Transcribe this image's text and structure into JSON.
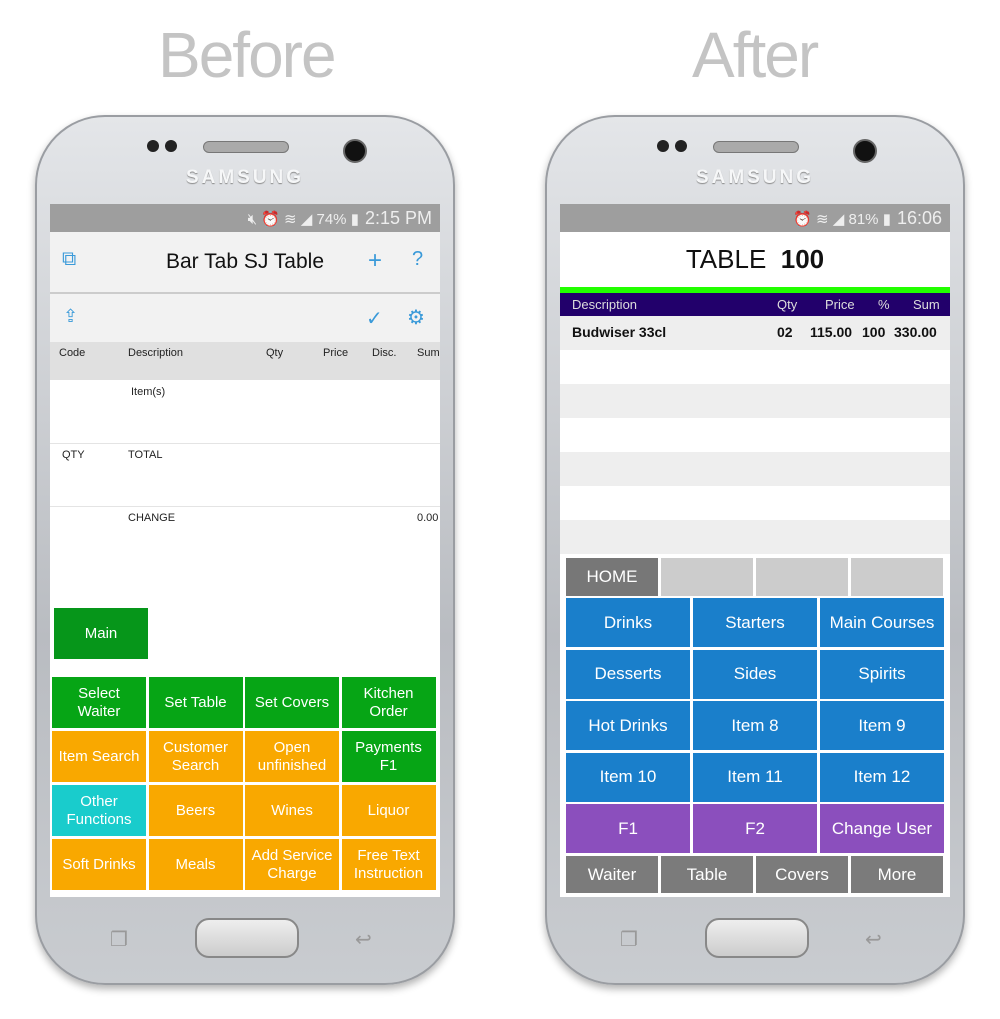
{
  "labels": {
    "before": "Before",
    "after": "After"
  },
  "brand": "SAMSUNG",
  "colors": {
    "green": "#06a515",
    "orange": "#f9a800",
    "cyan": "#19cccc",
    "blue": "#1a7fcb",
    "purple": "#8b4fbd",
    "header_purple": "#22006b",
    "accent_green": "#22ff00"
  },
  "before": {
    "status": {
      "battery": "74%",
      "time": "2:15 PM"
    },
    "title": "Bar Tab SJ Table",
    "icons": [
      "copy-icon",
      "plus-icon",
      "help-icon",
      "share-icon",
      "check-icon",
      "gear-icon"
    ],
    "columns": [
      "Code",
      "Description",
      "Qty",
      "Price",
      "Disc.",
      "Sum"
    ],
    "items_label": "Item(s)",
    "qty_label": "QTY",
    "total_label": "TOTAL",
    "change_label": "CHANGE",
    "change_value": "0.00",
    "main_button": "Main",
    "grid": [
      {
        "label": "Select Waiter",
        "color": "green"
      },
      {
        "label": "Set Table",
        "color": "green"
      },
      {
        "label": "Set Covers",
        "color": "green"
      },
      {
        "label": "Kitchen Order",
        "color": "green"
      },
      {
        "label": "Item Search",
        "color": "orange"
      },
      {
        "label": "Customer Search",
        "color": "orange"
      },
      {
        "label": "Open unfinished",
        "color": "orange"
      },
      {
        "label": "Payments F1",
        "color": "green"
      },
      {
        "label": "Other Functions",
        "color": "cyan"
      },
      {
        "label": "Beers",
        "color": "orange"
      },
      {
        "label": "Wines",
        "color": "orange"
      },
      {
        "label": "Liquor",
        "color": "orange"
      },
      {
        "label": "Soft Drinks",
        "color": "orange"
      },
      {
        "label": "Meals",
        "color": "orange"
      },
      {
        "label": "Add Service Charge",
        "color": "orange"
      },
      {
        "label": "Free Text Instruction",
        "color": "orange"
      }
    ]
  },
  "after": {
    "status": {
      "battery": "81%",
      "time": "16:06"
    },
    "title_prefix": "TABLE",
    "title_number": "100",
    "columns": [
      "Description",
      "Qty",
      "Price",
      "%",
      "Sum"
    ],
    "rows": [
      {
        "description": "Budwiser 33cl",
        "qty": "02",
        "price": "115.00",
        "pct": "100",
        "sum": "330.00"
      }
    ],
    "tabs": [
      "HOME",
      "",
      "",
      ""
    ],
    "grid": [
      "Drinks",
      "Starters",
      "Main Courses",
      "Desserts",
      "Sides",
      "Spirits",
      "Hot Drinks",
      "Item 8",
      "Item 9",
      "Item 10",
      "Item 11",
      "Item 12"
    ],
    "function_row": [
      "F1",
      "F2",
      "Change User"
    ],
    "bottom_row": [
      "Waiter",
      "Table",
      "Covers",
      "More"
    ]
  }
}
